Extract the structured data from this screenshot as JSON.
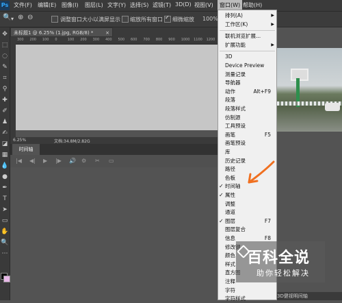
{
  "menubar": {
    "logo": "Ps",
    "items": [
      "文件(F)",
      "编辑(E)",
      "图像(I)",
      "图层(L)",
      "文字(Y)",
      "选择(S)",
      "滤镜(T)",
      "3D(D)",
      "视图(V)",
      "窗口(W)",
      "帮助(H)"
    ]
  },
  "options": {
    "zoom_in": "⊕",
    "zoom_out": "⊖",
    "resize_label": "调整窗口大小以满屏显示",
    "zoom_all_label": "缩放所有窗口",
    "scrubby_label": "细微缩放",
    "zoom_value": "100%"
  },
  "document": {
    "tab_title": "未标题1 @ 6.25% (1.jpg, RGB/8) *",
    "close": "×",
    "ruler_marks": [
      "300",
      "200",
      "100",
      "0",
      "100",
      "200",
      "300",
      "400",
      "500",
      "600",
      "700",
      "800",
      "900",
      "1000",
      "1100",
      "1200"
    ]
  },
  "status": {
    "zoom": "6.25%",
    "doc_info": "文档:34.8M/2.82G"
  },
  "timeline": {
    "tab_label": "时间轴",
    "controls": [
      "|◀",
      "◀|",
      "▶",
      "|▶",
      "🔊",
      "⚙",
      "✂",
      "▭"
    ]
  },
  "window_menu": {
    "items": [
      {
        "label": "排列(A)",
        "arrow": "▶"
      },
      {
        "label": "工作区(K)",
        "arrow": "▶"
      },
      {
        "sep": true
      },
      {
        "label": "联机浏览扩展..."
      },
      {
        "label": "扩展功能",
        "arrow": "▶"
      },
      {
        "sep": true
      },
      {
        "label": "3D"
      },
      {
        "label": "Device Preview"
      },
      {
        "label": "测量记录"
      },
      {
        "label": "导航器"
      },
      {
        "label": "动作",
        "shortcut": "Alt+F9"
      },
      {
        "label": "段落"
      },
      {
        "label": "段落样式"
      },
      {
        "label": "仿制源"
      },
      {
        "label": "工具预设"
      },
      {
        "label": "画笔",
        "shortcut": "F5"
      },
      {
        "label": "画笔预设"
      },
      {
        "label": "库"
      },
      {
        "label": "历史记录"
      },
      {
        "label": "路径"
      },
      {
        "label": "色板"
      },
      {
        "label": "时间轴",
        "checked": true
      },
      {
        "label": "属性",
        "checked": true
      },
      {
        "label": "调整"
      },
      {
        "label": "通道"
      },
      {
        "label": "图层",
        "shortcut": "F7",
        "checked": true
      },
      {
        "label": "图层复合"
      },
      {
        "label": "信息",
        "shortcut": "F8"
      },
      {
        "label": "修改键"
      },
      {
        "label": "颜色"
      },
      {
        "label": "样式"
      },
      {
        "label": "直方图"
      },
      {
        "label": "注释"
      },
      {
        "label": "字符"
      },
      {
        "label": "字符样式"
      }
    ]
  },
  "watermark": {
    "title": "百科全说",
    "subtitle": "助你轻松解决"
  },
  "bottom_status": "3D健视明间轴",
  "colors": {
    "arrow": "#f07020",
    "menu_highlight": "#bcbcbc"
  }
}
